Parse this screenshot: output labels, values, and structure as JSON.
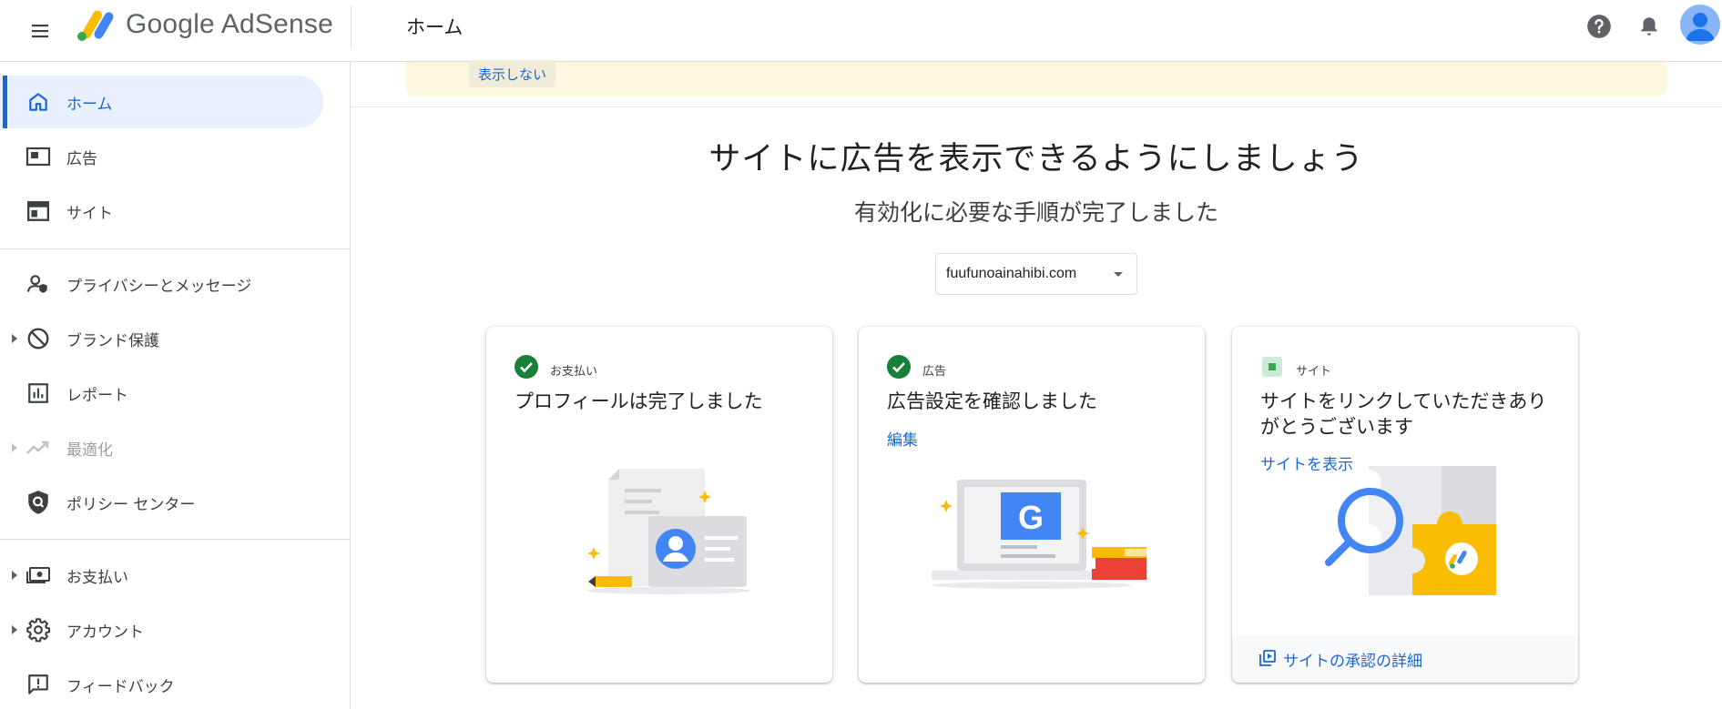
{
  "header": {
    "brand": "Google AdSense",
    "page_title": "ホーム"
  },
  "sidebar": {
    "items": [
      {
        "label": "ホーム",
        "icon": "home-icon",
        "active": true
      },
      {
        "label": "広告",
        "icon": "ads-icon"
      },
      {
        "label": "サイト",
        "icon": "sites-icon"
      },
      {
        "label": "プライバシーとメッセージ",
        "icon": "privacy-icon"
      },
      {
        "label": "ブランド保護",
        "icon": "block-icon",
        "expandable": true
      },
      {
        "label": "レポート",
        "icon": "reports-icon"
      },
      {
        "label": "最適化",
        "icon": "trending-up-icon",
        "expandable": true,
        "disabled": true
      },
      {
        "label": "ポリシー センター",
        "icon": "policy-icon"
      },
      {
        "label": "お支払い",
        "icon": "payments-icon",
        "expandable": true
      },
      {
        "label": "アカウント",
        "icon": "gear-icon",
        "expandable": true
      },
      {
        "label": "フィードバック",
        "icon": "feedback-icon"
      }
    ]
  },
  "banner": {
    "dismiss_label": "表示しない"
  },
  "main": {
    "title": "サイトに広告を表示できるようにしましょう",
    "subtitle": "有効化に必要な手順が完了しました",
    "site_select": "fuufunoainahibi.com",
    "cards": [
      {
        "category": "お支払い",
        "title": "プロフィールは完了しました",
        "status": "complete"
      },
      {
        "category": "広告",
        "title": "広告設定を確認しました",
        "link": "編集",
        "status": "complete"
      },
      {
        "category": "サイト",
        "title": "サイトをリンクしていただきありがとうございます",
        "link": "サイトを表示",
        "footer": "サイトの承認の詳細",
        "status": "pending"
      }
    ]
  },
  "colors": {
    "accent": "#1967d2",
    "success": "#188038",
    "banner": "#fef7e0",
    "active_nav": "#e8f0fe"
  }
}
